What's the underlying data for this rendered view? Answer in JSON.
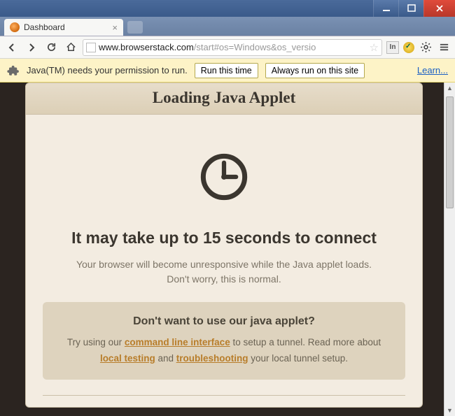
{
  "window": {
    "tab_title": "Dashboard"
  },
  "url": {
    "host": "www.browserstack.com",
    "path": "/start#os=Windows&os_versio"
  },
  "infobar": {
    "message": "Java(TM) needs your permission to run.",
    "run_once": "Run this time",
    "run_always": "Always run on this site",
    "learn": "Learn..."
  },
  "card": {
    "title": "Loading Java Applet",
    "headline": "It may take up to 15 seconds to connect",
    "sub1": "Your browser will become unresponsive while the Java applet loads.",
    "sub2": "Don't worry, this is normal."
  },
  "alt": {
    "title": "Don't want to use our java applet?",
    "pre": "Try using our ",
    "link_cli": "command line interface",
    "mid": " to setup a tunnel. Read more about ",
    "link_local": "local testing",
    "and": " and ",
    "link_trouble": "troubleshooting",
    "post": " your local tunnel setup."
  },
  "ext": {
    "in_label": "In"
  }
}
